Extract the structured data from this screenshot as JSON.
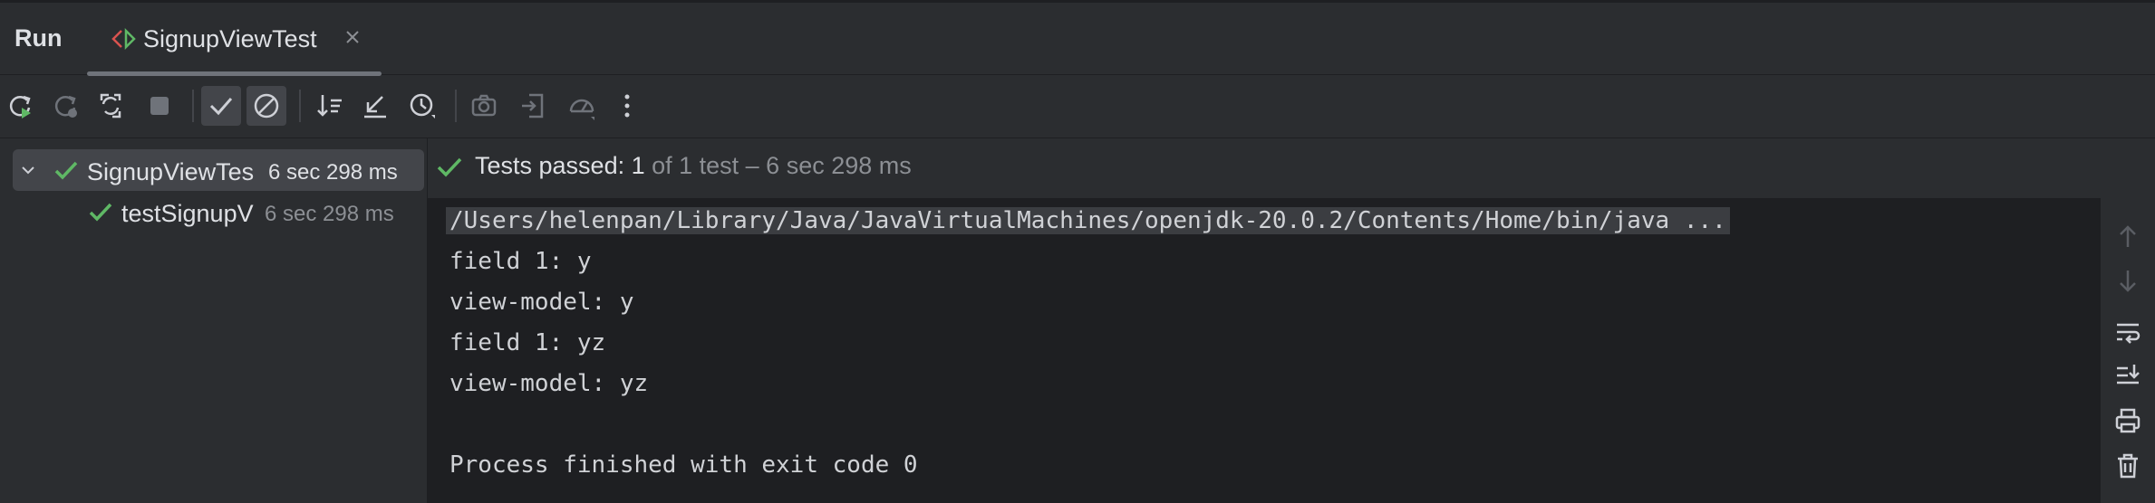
{
  "header": {
    "run_label": "Run",
    "tab_label": "SignupViewTest"
  },
  "toolbar": {
    "buttons": [
      "rerun-icon",
      "rerun-failed-icon",
      "toggle-auto-test-icon",
      "stop-icon",
      "show-passed-icon",
      "show-ignored-icon",
      "sort-icon",
      "collapse-icon",
      "history-icon",
      "screenshot-icon",
      "import-icon",
      "coverage-icon",
      "more-icon"
    ]
  },
  "tree": {
    "root": {
      "name": "SignupViewTes",
      "time": "6 sec 298 ms"
    },
    "child": {
      "name": "testSignupV",
      "time": "6 sec 298 ms"
    }
  },
  "status": {
    "main": "Tests passed: 1",
    "rest": " of 1 test – 6 sec 298 ms"
  },
  "console": {
    "lines": [
      "/Users/helenpan/Library/Java/JavaVirtualMachines/openjdk-20.0.2/Contents/Home/bin/java ...",
      "field 1: y",
      "view-model: y",
      "field 1: yz",
      "view-model: yz",
      "",
      "Process finished with exit code 0"
    ]
  },
  "colors": {
    "success": "#5fb865",
    "background": "#2b2d30",
    "console_bg": "#1e1f22"
  }
}
